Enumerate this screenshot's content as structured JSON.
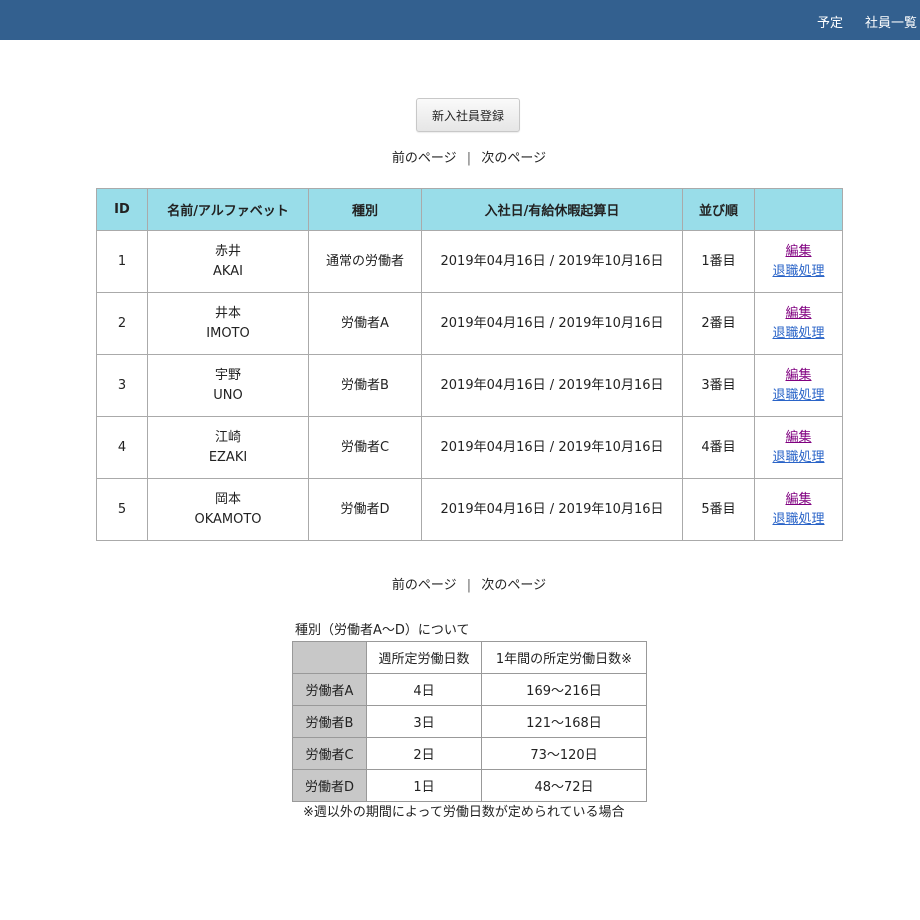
{
  "nav": {
    "schedule": "予定",
    "employees": "社員一覧"
  },
  "register_button": "新入社員登録",
  "pager": {
    "prev": "前のページ",
    "separator": "|",
    "next": "次のページ"
  },
  "employee_table": {
    "headers": [
      "ID",
      "名前/アルファベット",
      "種別",
      "入社日/有給休暇起算日",
      "並び順",
      ""
    ],
    "rows": [
      {
        "id": "1",
        "name": "赤井",
        "alpha": "AKAI",
        "type": "通常の労働者",
        "dates": "2019年04月16日 / 2019年10月16日",
        "order": "1番目",
        "edit": "編集",
        "retire": "退職処理"
      },
      {
        "id": "2",
        "name": "井本",
        "alpha": "IMOTO",
        "type": "労働者A",
        "dates": "2019年04月16日 / 2019年10月16日",
        "order": "2番目",
        "edit": "編集",
        "retire": "退職処理"
      },
      {
        "id": "3",
        "name": "宇野",
        "alpha": "UNO",
        "type": "労働者B",
        "dates": "2019年04月16日 / 2019年10月16日",
        "order": "3番目",
        "edit": "編集",
        "retire": "退職処理"
      },
      {
        "id": "4",
        "name": "江崎",
        "alpha": "EZAKI",
        "type": "労働者C",
        "dates": "2019年04月16日 / 2019年10月16日",
        "order": "4番目",
        "edit": "編集",
        "retire": "退職処理"
      },
      {
        "id": "5",
        "name": "岡本",
        "alpha": "OKAMOTO",
        "type": "労働者D",
        "dates": "2019年04月16日 / 2019年10月16日",
        "order": "5番目",
        "edit": "編集",
        "retire": "退職処理"
      }
    ]
  },
  "legend": {
    "caption": "種別（労働者A〜D）について",
    "headers": [
      "",
      "週所定労働日数",
      "1年間の所定労働日数※"
    ],
    "rows": [
      {
        "type": "労働者A",
        "weekly": "4日",
        "yearly": "169〜216日"
      },
      {
        "type": "労働者B",
        "weekly": "3日",
        "yearly": "121〜168日"
      },
      {
        "type": "労働者C",
        "weekly": "2日",
        "yearly": "73〜120日"
      },
      {
        "type": "労働者D",
        "weekly": "1日",
        "yearly": "48〜72日"
      }
    ],
    "note": "※週以外の期間によって労働日数が定められている場合"
  },
  "colors": {
    "navbar": "#33608f",
    "table_header": "#99dde9",
    "legend_header": "#c8c8c8",
    "edit_link": "#800080",
    "retire_link": "#2a64c8"
  }
}
